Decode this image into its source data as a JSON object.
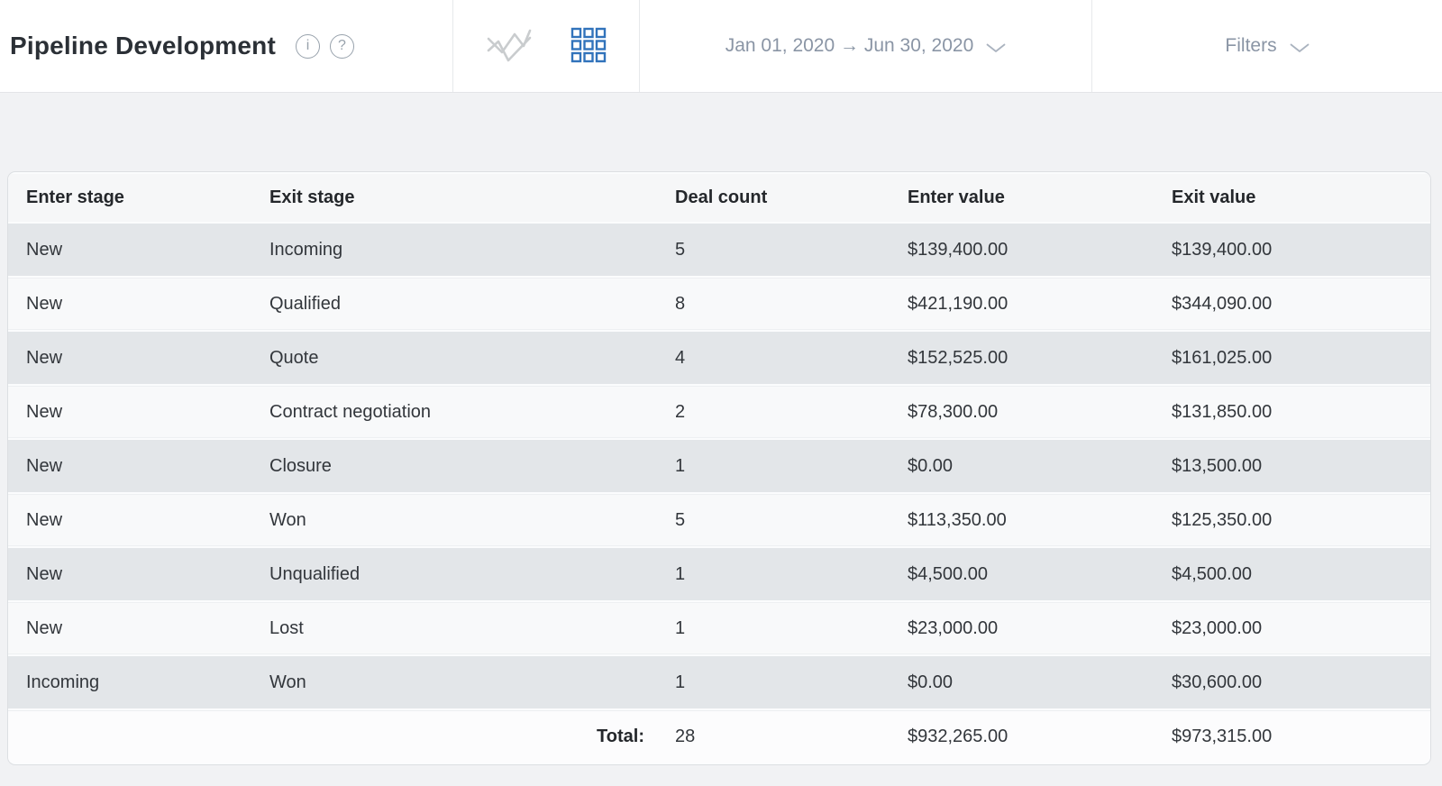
{
  "header": {
    "title": "Pipeline Development",
    "info_icon_glyph": "i",
    "help_icon_glyph": "?",
    "date_range": "Jan 01, 2020 → Jun 30, 2020",
    "filters_label": "Filters",
    "active_view": "table"
  },
  "colors": {
    "accent_blue": "#3173bb",
    "muted_text": "#8a95a5",
    "row_stripe_dark": "#e3e6e9",
    "row_stripe_light": "#f8f9fa",
    "page_background": "#f1f2f4"
  },
  "table": {
    "columns": {
      "enter_stage": "Enter stage",
      "exit_stage": "Exit stage",
      "deal_count": "Deal count",
      "enter_value": "Enter value",
      "exit_value": "Exit value"
    },
    "rows": [
      {
        "enter_stage": "New",
        "exit_stage": "Incoming",
        "deal_count": "5",
        "enter_value": "$139,400.00",
        "exit_value": "$139,400.00"
      },
      {
        "enter_stage": "New",
        "exit_stage": "Qualified",
        "deal_count": "8",
        "enter_value": "$421,190.00",
        "exit_value": "$344,090.00"
      },
      {
        "enter_stage": "New",
        "exit_stage": "Quote",
        "deal_count": "4",
        "enter_value": "$152,525.00",
        "exit_value": "$161,025.00"
      },
      {
        "enter_stage": "New",
        "exit_stage": "Contract negotiation",
        "deal_count": "2",
        "enter_value": "$78,300.00",
        "exit_value": "$131,850.00"
      },
      {
        "enter_stage": "New",
        "exit_stage": "Closure",
        "deal_count": "1",
        "enter_value": "$0.00",
        "exit_value": "$13,500.00"
      },
      {
        "enter_stage": "New",
        "exit_stage": "Won",
        "deal_count": "5",
        "enter_value": "$113,350.00",
        "exit_value": "$125,350.00"
      },
      {
        "enter_stage": "New",
        "exit_stage": "Unqualified",
        "deal_count": "1",
        "enter_value": "$4,500.00",
        "exit_value": "$4,500.00"
      },
      {
        "enter_stage": "New",
        "exit_stage": "Lost",
        "deal_count": "1",
        "enter_value": "$23,000.00",
        "exit_value": "$23,000.00"
      },
      {
        "enter_stage": "Incoming",
        "exit_stage": "Won",
        "deal_count": "1",
        "enter_value": "$0.00",
        "exit_value": "$30,600.00"
      }
    ],
    "total": {
      "label": "Total:",
      "deal_count": "28",
      "enter_value": "$932,265.00",
      "exit_value": "$973,315.00"
    }
  }
}
